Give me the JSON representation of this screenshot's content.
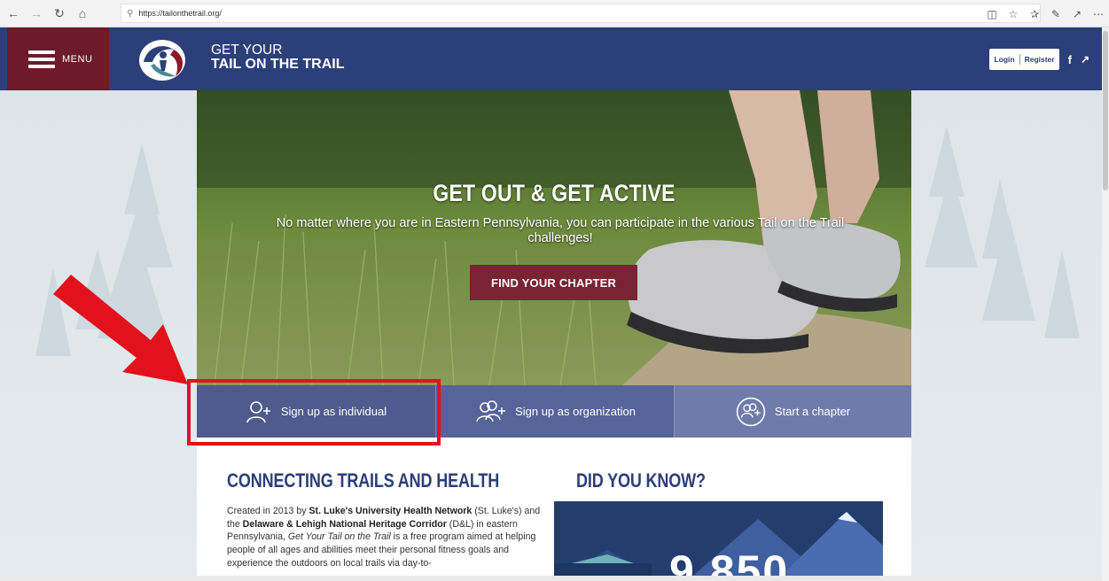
{
  "browser": {
    "url": "https://tailonthetrail.org/",
    "nav_icons": [
      "back-icon",
      "forward-icon",
      "refresh-icon",
      "home-icon"
    ]
  },
  "header": {
    "menu_label": "MENU",
    "brand_line1": "GET YOUR",
    "brand_line2": "TAIL ON THE TRAIL",
    "login_label": "Login",
    "register_label": "Register",
    "facebook_label": "f",
    "colors": {
      "primary": "#2d3f79",
      "accent": "#6d1a2a"
    }
  },
  "hero": {
    "title": "GET OUT & GET ACTIVE",
    "subtitle": "No matter where you are in Eastern Pennsylvania, you can participate in the various Tail on the Trail challenges!",
    "cta_label": "FIND YOUR CHAPTER",
    "cta_color": "#7a2333"
  },
  "signup": {
    "individual_label": "Sign up as individual",
    "organization_label": "Sign up as organization",
    "chapter_label": "Start a chapter"
  },
  "content": {
    "left_title": "CONNECTING TRAILS AND HEALTH",
    "right_title": "DID YOU KNOW?",
    "body_prefix": "Created in 2013 by ",
    "body_org1": "St. Luke's University Health Network",
    "body_mid1": " (St. Luke's) and the ",
    "body_org2": "Delaware & Lehigh National Heritage Corridor",
    "body_mid2": " (D&L) in eastern Pennsylvania, ",
    "body_program": "Get Your Tail on the Trail",
    "body_suffix": " is a free program aimed at helping people of all ages and abilities meet their personal fitness goals and experience the outdoors on local trails via day-to-",
    "stat_partial": "9,850"
  },
  "annotation": {
    "highlight_color": "#e3111b"
  }
}
